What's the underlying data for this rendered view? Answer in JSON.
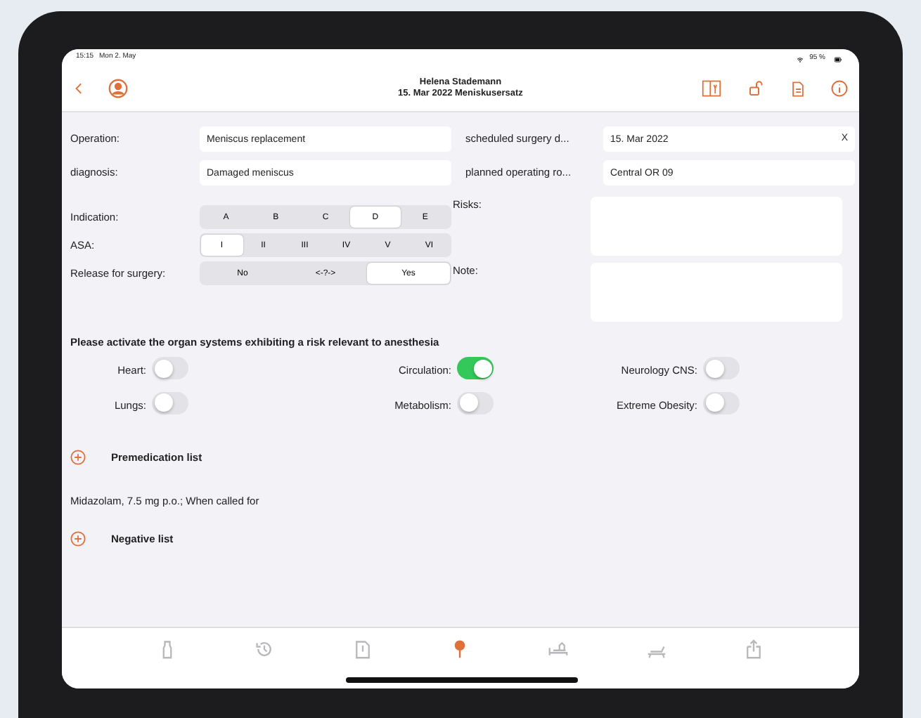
{
  "status_bar": {
    "time": "15:15",
    "date": "Mon 2. May",
    "battery": "95 %"
  },
  "header": {
    "title": "Helena Stademann",
    "subtitle": "15. Mar 2022  Meniskusersatz"
  },
  "fields": [
    {
      "label": "Operation:",
      "value": "Meniscus replacement"
    },
    {
      "label": "scheduled surgery d...",
      "value": "15. Mar 2022",
      "clear": "X"
    },
    {
      "label": "diagnosis:",
      "value": "Damaged meniscus"
    },
    {
      "label": "planned operating ro...",
      "value": "Central OR 09"
    }
  ],
  "segments": [
    {
      "label": "Indication:",
      "options": [
        {
          "label": "A",
          "selected": false
        },
        {
          "label": "B",
          "selected": false
        },
        {
          "label": "C",
          "selected": false
        },
        {
          "label": "D",
          "selected": true
        },
        {
          "label": "E",
          "selected": false
        }
      ]
    },
    {
      "label": "ASA:",
      "options": [
        {
          "label": "I",
          "selected": true
        },
        {
          "label": "II",
          "selected": false
        },
        {
          "label": "III",
          "selected": false
        },
        {
          "label": "IV",
          "selected": false
        },
        {
          "label": "V",
          "selected": false
        },
        {
          "label": "VI",
          "selected": false
        }
      ]
    },
    {
      "label": "Release for surgery:",
      "options": [
        {
          "label": "No",
          "selected": false
        },
        {
          "label": "<-?->",
          "selected": false
        },
        {
          "label": "Yes",
          "selected": true
        }
      ]
    }
  ],
  "notes": [
    {
      "label": "Risks:"
    },
    {
      "label": "Note:"
    }
  ],
  "organs": {
    "heading": "Please activate the organ systems exhibiting a risk relevant to anesthesia",
    "toggles": [
      {
        "label": "Heart:",
        "on": false
      },
      {
        "label": "Circulation:",
        "on": true
      },
      {
        "label": "Neurology CNS:",
        "on": false
      },
      {
        "label": "Lungs:",
        "on": false
      },
      {
        "label": "Metabolism:",
        "on": false
      },
      {
        "label": "Extreme Obesity:",
        "on": false
      }
    ]
  },
  "lists": [
    {
      "title": "Premedication list",
      "items": [
        "Midazolam, 7.5 mg p.o.; When called for"
      ]
    },
    {
      "title": "Negative list"
    }
  ],
  "tab_bar": [
    {
      "kind": "bottle",
      "selected": false
    },
    {
      "kind": "history",
      "selected": false
    },
    {
      "kind": "document",
      "selected": false
    },
    {
      "kind": "pin",
      "selected": true
    },
    {
      "kind": "bed",
      "selected": false
    },
    {
      "kind": "stretcher",
      "selected": false
    },
    {
      "kind": "export",
      "selected": false
    }
  ]
}
